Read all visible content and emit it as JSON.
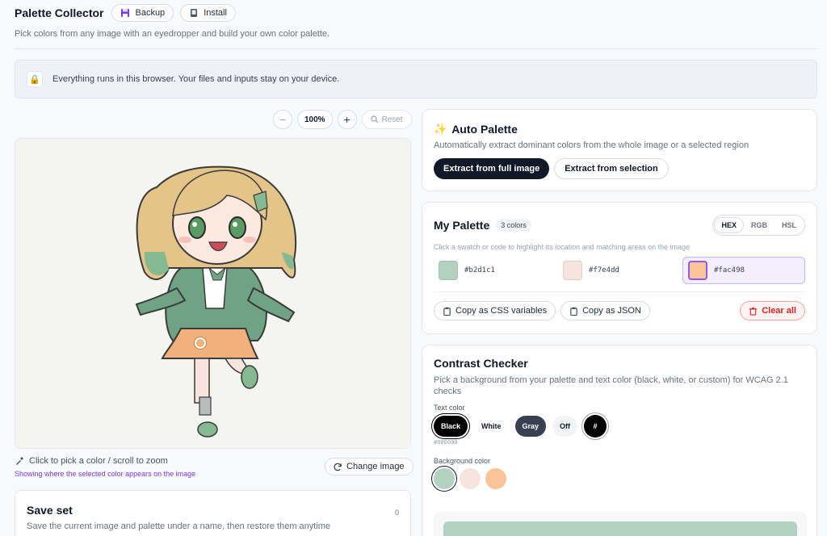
{
  "header": {
    "app_title": "Palette Collector",
    "backup_label": "Backup",
    "install_label": "Install",
    "subtitle": "Pick colors from any image with an eyedropper and build your own color palette."
  },
  "notice": {
    "text": "Everything runs in this browser. Your files and inputs stay on your device.",
    "icon": "lock-icon"
  },
  "zoom": {
    "minus": "−",
    "value": "100%",
    "plus": "+",
    "reset_label": "Reset"
  },
  "image_panel": {
    "hint": "Click to pick a color / scroll to zoom",
    "sub_hint": "Showing where the selected color appears on the image",
    "change_label": "Change image"
  },
  "save_set": {
    "title": "Save set",
    "subtitle": "Save the current image and palette under a name, then restore them anytime",
    "count": "0"
  },
  "auto_palette": {
    "title": "Auto Palette",
    "subtitle": "Automatically extract dominant colors from the whole image or a selected region",
    "full_label": "Extract from full image",
    "selection_label": "Extract from selection"
  },
  "my_palette": {
    "title": "My Palette",
    "count_badge": "3 colors",
    "formats": [
      "HEX",
      "RGB",
      "HSL"
    ],
    "active_format": "HEX",
    "hint": "Click a swatch or code to highlight its location and matching areas on the image",
    "swatches": [
      {
        "code": "#b2d1c1",
        "color": "#b2d1c1"
      },
      {
        "code": "#f7e4dd",
        "color": "#f7e4dd"
      },
      {
        "code": "#fac498",
        "color": "#fac498"
      }
    ],
    "copy_css_label": "Copy as CSS variables",
    "copy_json_label": "Copy as JSON",
    "clear_label": "Clear all"
  },
  "contrast": {
    "title": "Contrast Checker",
    "subtitle": "Pick a background from your palette and text color (black, white, or custom) for WCAG 2.1 checks",
    "text_color_label": "Text color",
    "text_options": [
      "Black",
      "White",
      "Gray",
      "Off"
    ],
    "custom_label": "#",
    "current_hex": "#000000",
    "bg_label": "Background color",
    "bg_colors": [
      "#b2d1c1",
      "#f7e4dd",
      "#fac498"
    ],
    "selected_bg": "#b2d1c1"
  },
  "colors": {
    "accent": "#7c3aed",
    "danger": "#dc2626",
    "dark": "#111827"
  }
}
